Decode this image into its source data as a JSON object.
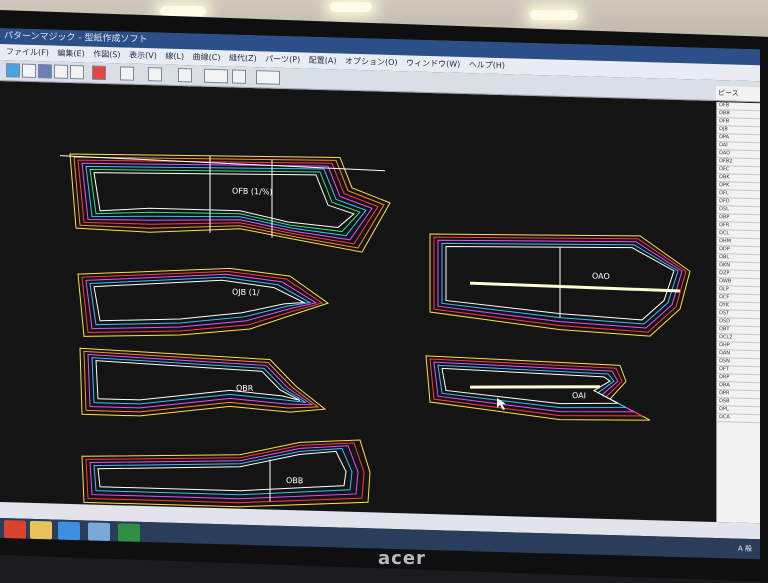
{
  "window": {
    "title": "パターンマジック - 型紙作成ソフト"
  },
  "menubar": {
    "items": [
      "ファイル(F)",
      "編集(E)",
      "作図(S)",
      "表示(V)",
      "線(L)",
      "曲線(C)",
      "縫代(Z)",
      "パーツ(P)",
      "配置(A)",
      "オプション(O)",
      "ウィンドウ(W)",
      "ヘルプ(H)"
    ]
  },
  "right_panel": {
    "header": "ピース",
    "rows": [
      "OFB",
      "OBB",
      "OFB",
      "OJB",
      "OPA",
      "OAI",
      "OAO",
      "OFB2",
      "OFC",
      "OBK",
      "OPK",
      "OFL",
      "OFD",
      "OSL",
      "OBP",
      "OFR",
      "OCL",
      "OHM",
      "ODP",
      "OBL",
      "OKN",
      "OZP",
      "OWB",
      "OLP",
      "OCF",
      "OYK",
      "OST",
      "OSD",
      "OBT",
      "OCL2",
      "OHP",
      "OAN",
      "OSN",
      "OFT",
      "ORP",
      "OBA",
      "OPR",
      "OSB",
      "OPL",
      "OCA"
    ]
  },
  "pieces": [
    {
      "label": "OFB (1/%)",
      "colorAccent": "#ffffff"
    },
    {
      "label": "OJB (1/",
      "colorAccent": "#ffffff"
    },
    {
      "label": "OBR",
      "colorAccent": "#ffffff"
    },
    {
      "label": "OBB",
      "colorAccent": "#ffffff"
    },
    {
      "label": "OAO",
      "colorAccent": "#ffffff"
    },
    {
      "label": "OAI",
      "colorAccent": "#ffffff"
    }
  ],
  "grading_colors": [
    "#ffe04a",
    "#ff8a2a",
    "#ff3b3b",
    "#e64dff",
    "#7b6bff",
    "#33c2ff",
    "#3ee07a",
    "#ffffff"
  ],
  "taskbar": {
    "icons": [
      "start-icon",
      "folder-icon",
      "ie-icon",
      "app-icon",
      "excel-icon"
    ],
    "tray_text": "A 般"
  },
  "monitor": {
    "brand": "acer"
  }
}
